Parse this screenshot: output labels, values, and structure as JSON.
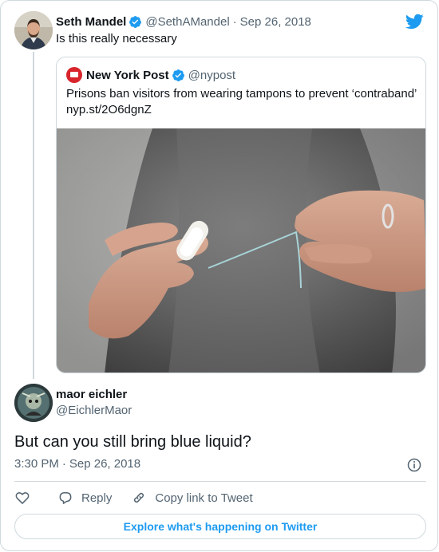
{
  "colors": {
    "accent": "#1d9bf0",
    "text": "#0f1419",
    "muted": "#536471",
    "border": "#cfd9de",
    "nypost_red": "#d8242b"
  },
  "parent_tweet": {
    "name": "Seth Mandel",
    "handle": "@SethAMandel",
    "date": "Sep 26, 2018",
    "text": "Is this really necessary",
    "avatar_icon": "profile-photo-man-bearded",
    "verified_icon": "verified-badge-icon"
  },
  "quoted_tweet": {
    "name": "New York Post",
    "handle": "@nypost",
    "text": "Prisons ban visitors from wearing tampons to prevent ‘contraband’ nyp.st/2O6dgnZ",
    "avatar_icon": "nypost-logo",
    "media_icon": "photo-hands-holding-tampon"
  },
  "main_tweet": {
    "name": "maor eichler",
    "handle": "@EichlerMaor",
    "text": "But can you still bring blue liquid?",
    "time": "3:30 PM",
    "date": "Sep 26, 2018"
  },
  "actions": {
    "like_icon": "heart-icon",
    "reply_label": "Reply",
    "copy_label": "Copy link to Tweet"
  },
  "explore_label": "Explore what's happening on Twitter",
  "brand_icon": "twitter-bird-icon"
}
